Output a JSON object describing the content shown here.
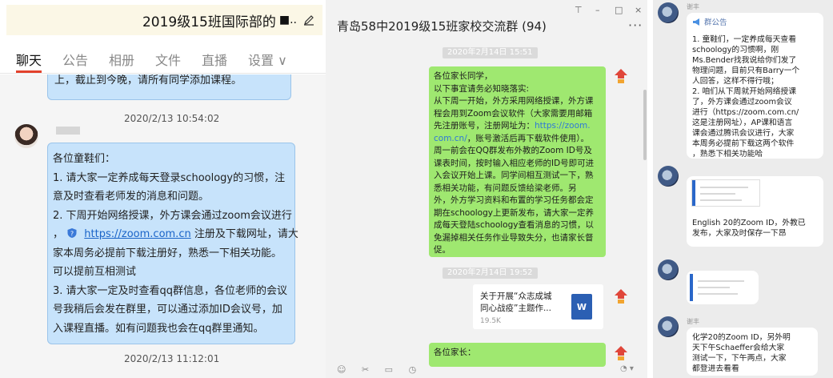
{
  "colors": {
    "p1_bubble": "#c7e3fb",
    "p1_bubble_border": "#9ac4ea",
    "tab_accent": "#e3412c",
    "p2_bubble": "#9fe870",
    "link": "#1a64c8",
    "word_icon": "#2b5fb3"
  },
  "panel1": {
    "title": "2019级15班国际部的",
    "title_tail": "■..",
    "edit_icon": "pencil-icon",
    "tabs": [
      {
        "label": "聊天",
        "active": true
      },
      {
        "label": "公告",
        "active": false
      },
      {
        "label": "相册",
        "active": false
      },
      {
        "label": "文件",
        "active": false
      },
      {
        "label": "直播",
        "active": false
      },
      {
        "label": "设置 ∨",
        "active": false
      }
    ],
    "msg1_text": "上，截止到今晚，请所有同学添加课程。",
    "ts1": "2020/2/13 10:54:02",
    "msg2_lines": {
      "l1": "各位童鞋们：",
      "l2": "1. 请大家一定养成每天登录schoology的习惯，注",
      "l3": "意及时查看老师发的消息和问题。",
      "l4": "2. 下周开始网络授课，外方课会通过zoom会议进行",
      "l5_pre": "，",
      "l5_link": "https://zoom.com.cn",
      "l5_post": "注册及下载网址，请大",
      "l6": "家本周务必提前下载注册好，熟悉一下相关功能。",
      "l7": "可以提前互相测试",
      "l8": "3. 请大家一定及时查看qq群信息，各位老师的会议",
      "l9": "号我稍后会发在群里，可以通过添加ID会议号，加",
      "l10": "入课程直播。如有问题我也会在qq群里通知。"
    },
    "ts2": "2020/2/13 11:12:01"
  },
  "panel2": {
    "title": "青岛58中2019级15班家校交流群 (94)",
    "controls": {
      "pin": "⊤",
      "min": "–",
      "max": "□",
      "close": "×"
    },
    "more": "···",
    "stamp1": "2020年2月14日 15:51",
    "msg_lines": {
      "l1": "各位家长同学，",
      "l2": "以下事宜请务必知晓落实:",
      "l3": "从下周一开始，外方采用网络授课，外方课",
      "l4": "程会用到Zoom会议软件（大家需要用邮箱",
      "l5_pre": "先注册账号，注册网址为：",
      "l5_link": "https://zoom.",
      "l6_link": "com.cn/",
      "l6_post": "，账号激活后再下载软件使用）。",
      "l7": "周一前会在QQ群发布外教的Zoom ID号及",
      "l8": "课表时间，按时输入相应老师的ID号即可进",
      "l9": "入会议开始上课。同学间相互测试一下，熟",
      "l10": "悉相关功能，有问题反馈给梁老师。另",
      "l11": "外，外方学习资料和布置的学习任务都会定",
      "l12": "期在schoology上更新发布，请大家一定养",
      "l13": "成每天登陆schoology查看消息的习惯，以",
      "l14": "免漏掉相关任务作业导致失分，也请家长督",
      "l15": "促。"
    },
    "stamp2": "2020年2月14日 19:52",
    "file": {
      "name_l1": "关于开展“众志成城",
      "name_l2": "同心战疫”主题作...",
      "size": "19.5K",
      "icon_text": "W"
    },
    "msg3": "各位家长：",
    "bottom_icons": "☺ ✂ ▭ ◷",
    "bottom_right": "◔ ▾"
  },
  "panel3": {
    "name1": "谢丰",
    "notice_head": "群公告",
    "notice_lines": {
      "l1": "1. 童鞋们，一定养成每天查看",
      "l2": "schoology的习惯啊，刚",
      "l3": "Ms.Bender找我说给你们发了",
      "l4": "物理问题，目前只有Barry一个",
      "l5": "人回答，这样不得行哦；",
      "l6": "2. 咱们从下周就开始网络授课",
      "l7": "了，外方课会通过zoom会议",
      "l8": "进行（https://zoom.com.cn/",
      "l9": "这是注册网址），AP课和语言",
      "l10": "课会通过腾讯会议进行，大家",
      "l11": "本周务必提前下载这两个软件",
      "l12": "，熟悉下相关功能哈"
    },
    "msg2_lines": {
      "l1": "English 20的Zoom ID，外教已",
      "l2": "发布，大家及时保存一下昂"
    },
    "name4": "谢丰",
    "msg4_lines": {
      "l1": "化学20的Zoom ID，另外明",
      "l2": "天下午Schaeffer会给大家",
      "l3": "测试一下，下午两点，大家",
      "l4": "都登进去看看"
    }
  }
}
